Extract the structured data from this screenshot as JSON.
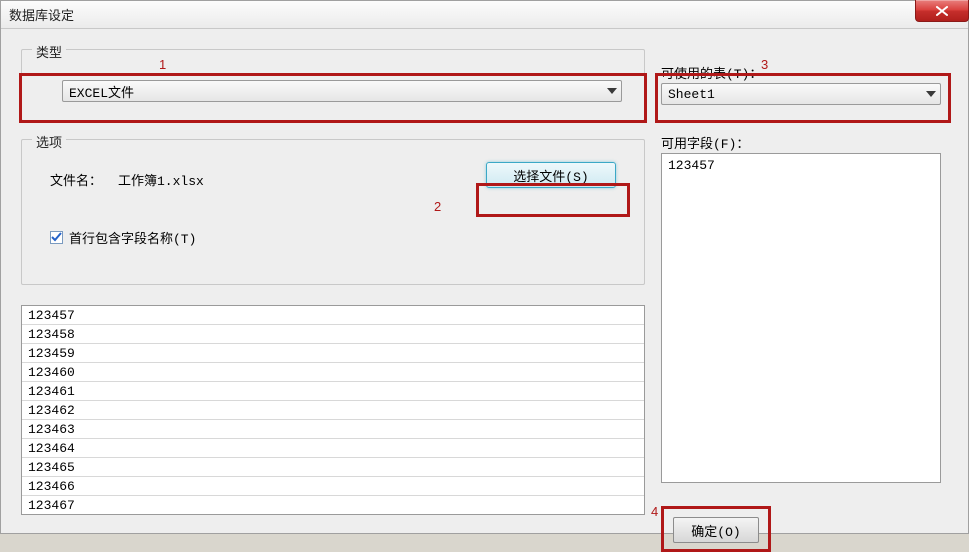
{
  "window": {
    "title": "数据库设定"
  },
  "annotations": {
    "a1": "1",
    "a2": "2",
    "a3": "3",
    "a4": "4"
  },
  "type_group": {
    "label": "类型",
    "combo_value": "EXCEL文件"
  },
  "options_group": {
    "label": "选项",
    "file_label": "文件名：",
    "file_name": "工作簿1.xlsx",
    "select_file_button": "选择文件(S)",
    "first_row_checkbox": {
      "label": "首行包含字段名称(T)",
      "checked": true
    }
  },
  "data_preview": {
    "rows": [
      "123457",
      "123458",
      "123459",
      "123460",
      "123461",
      "123462",
      "123463",
      "123464",
      "123465",
      "123466",
      "123467"
    ]
  },
  "tables": {
    "label": "可使用的表(T)：",
    "combo_value": "Sheet1"
  },
  "fields": {
    "label": "可用字段(F)：",
    "items": [
      "123457"
    ]
  },
  "buttons": {
    "ok": "确定(O)"
  }
}
